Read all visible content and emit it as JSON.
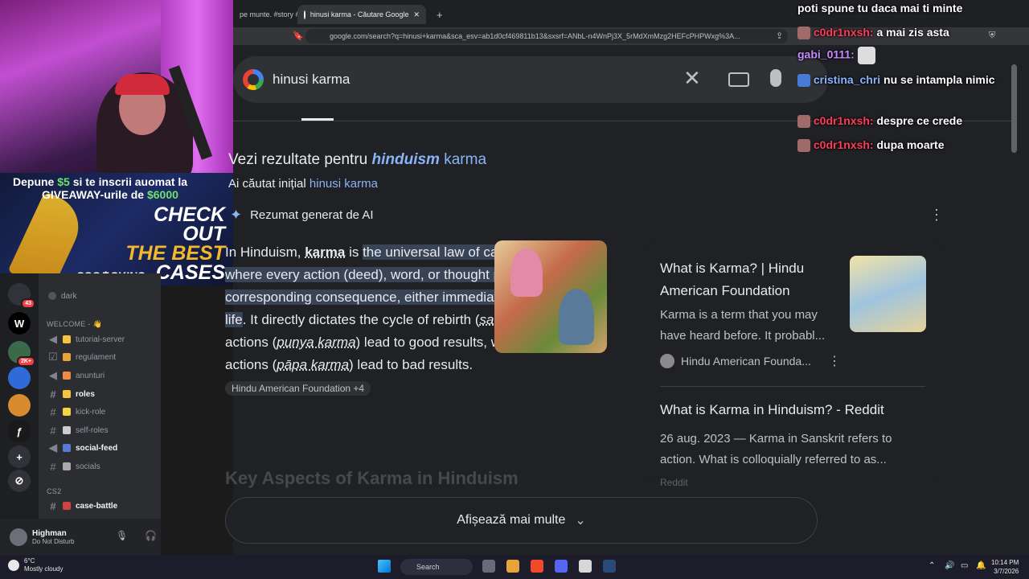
{
  "browser": {
    "tabs": [
      {
        "label": "pe munte. #story #"
      },
      {
        "label": "hinusi karma - Căutare Google"
      }
    ],
    "new_tab_label": "+",
    "url": "google.com/search?q=hinusi+karma&sca_esv=ab1d0cf469811b13&sxsrf=ANbL-n4WnPj3X_5rMdXmMzg2HEFcPHPWxg%3A...",
    "search_query": "hinusi karma",
    "clear_label": "✕"
  },
  "results": {
    "see_prefix": "Vezi rezultate pentru",
    "see_bold": "hinduism",
    "see_suffix": "karma",
    "orig_prefix": "Ai căutat inițial",
    "orig_link": "hinusi karma",
    "ai_label": "Rezumat generat de AI",
    "para_1": "In Hinduism,",
    "para_bold": "karma",
    "para_2": "is",
    "para_hl": "the universal law of cause and effect, where every action (deed), word, or thought produces a corresponding consequence, either immediately or in a future life",
    "para_3": ". It directly dictates the cycle of rebirth (",
    "samsara": "samsara",
    "para_4": "). Positive actions (",
    "punya": "punya karma",
    "para_5": ") lead to good results, while negative actions (",
    "papa": "pāpa karma",
    "para_6": ") lead to bad results.",
    "source_chip": "Hindu American Foundation +4",
    "key_heading": "Key Aspects of Karma in Hinduism",
    "show_more": "Afișează mai multe"
  },
  "side": {
    "card1_title": "What is Karma? | Hindu American Foundation",
    "card1_desc": "Karma is a term that you may have heard before. It probabl...",
    "card1_source": "Hindu American Founda...",
    "card2_title": "What is Karma in Hinduism? - Reddit",
    "card2_desc": "26 aug. 2023 — Karma in Sanskrit refers to action. What is colloquially referred to as...",
    "card2_source": "Reddit"
  },
  "chat": {
    "m0": "poti spune tu daca mai ti minte",
    "m1_user": "c0dr1nxsh:",
    "m1_text": "a mai zis asta",
    "m2_user": "gabi_0111:",
    "m3_user": "cristina_chri",
    "m3_text": "nu se intampla nimic",
    "m4_user": "c0dr1nxsh:",
    "m4_text": "despre ce crede",
    "m5_user": "c0dr1nxsh:",
    "m5_text": "dupa moarte"
  },
  "ad": {
    "line1_a": "Depune",
    "line1_money": "$5",
    "line1_b": "si te inscrii auomat la",
    "line2_a": "GIVEAWAY-urile de",
    "line2_money": "$6000",
    "check1": "CHECK OUT",
    "check2": "THE BEST",
    "check3": "CASES",
    "brand": "CSG⚙SKINS"
  },
  "discord": {
    "dark_label": "dark",
    "category_welcome": "WELCOME - 👋",
    "channels": [
      {
        "label": "tutorial-server"
      },
      {
        "label": "regulament"
      },
      {
        "label": "anunturi"
      },
      {
        "label": "roles"
      },
      {
        "label": "kick-role"
      },
      {
        "label": "self-roles"
      },
      {
        "label": "social-feed"
      },
      {
        "label": "socials"
      }
    ],
    "category_cs2": "CS2",
    "case_battle": "case-battle",
    "badges": [
      "43",
      "2K+"
    ],
    "user_name": "Highman",
    "user_status": "Do Not Disturb"
  },
  "taskbar": {
    "temp": "6°C",
    "weather": "Mostly cloudy",
    "search_placeholder": "Search",
    "time": "10:14 PM",
    "date": "3/7/2026"
  }
}
